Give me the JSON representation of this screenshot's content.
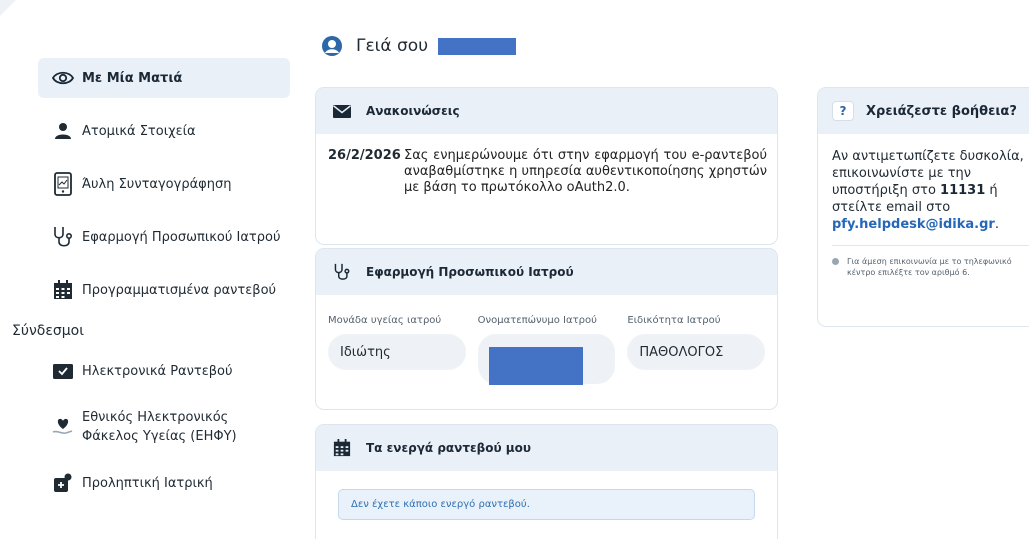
{
  "sidebar": {
    "items": [
      {
        "label": "Με Μία Ματιά",
        "icon": "eye-icon",
        "active": true
      },
      {
        "label": "Ατομικά Στοιχεία",
        "icon": "user-icon"
      },
      {
        "label": "Άυλη Συνταγογράφηση",
        "icon": "mobile-prescription-icon"
      },
      {
        "label": "Εφαρμογή Προσωπικού Ιατρού",
        "icon": "stethoscope-icon"
      },
      {
        "label": "Προγραμματισμένα ραντεβού",
        "icon": "calendar-icon"
      }
    ],
    "links_title": "Σύνδεσμοι",
    "links": [
      {
        "label": "Ηλεκτρονικά Ραντεβού",
        "icon": "calendar-check-icon"
      },
      {
        "line1": "Εθνικός Ηλεκτρονικός",
        "line2": "Φάκελος Υγείας (ΕΗΦΥ)",
        "icon": "heart-hand-icon"
      },
      {
        "label": "Προληπτική Ιατρική",
        "icon": "doctor-icon"
      }
    ]
  },
  "greeting": {
    "text": "Γειά σου"
  },
  "announcements": {
    "title": "Ανακοινώσεις",
    "date": "26/2/2026",
    "text": "Σας ενημερώνουμε ότι στην εφαρμογή του e-ραντεβού αναβαθμίστηκε η υπηρεσία αυθεντικοποίησης χρηστών με βάση το πρωτόκολλο oAuth2.0."
  },
  "personal_doctor": {
    "title": "Εφαρμογή Προσωπικού Ιατρού",
    "fields": [
      {
        "label": "Μονάδα υγείας ιατρού",
        "value": "Ιδιώτης"
      },
      {
        "label": "Ονοματεπώνυμο Ιατρού",
        "value": ""
      },
      {
        "label": "Ειδικότητα Ιατρού",
        "value": "ΠΑΘΟΛΟΓΟΣ"
      }
    ]
  },
  "active_appointments": {
    "title": "Τα ενεργά ραντεβού μου",
    "empty_text": "Δεν έχετε κάποιο ενεργό ραντεβού."
  },
  "help": {
    "icon_text": "?",
    "title": "Χρειάζεστε βοήθεια?",
    "text_1": "Αν αντιμετωπίζετε δυσκολία, επικοινωνίστε με την υποστήριξη στο ",
    "phone": "11131",
    "text_2": " ή στείλτε email στο ",
    "email": "pfy.helpdesk@idika.gr",
    "text_3": ".",
    "note": "Για άμεση επικοινωνία με το τηλεφωνικό κέντρο επιλέξτε τον αριθμό 6."
  },
  "colors": {
    "accent": "#2667b7",
    "card_header": "#e9f0f8",
    "redaction": "#4472c4"
  }
}
